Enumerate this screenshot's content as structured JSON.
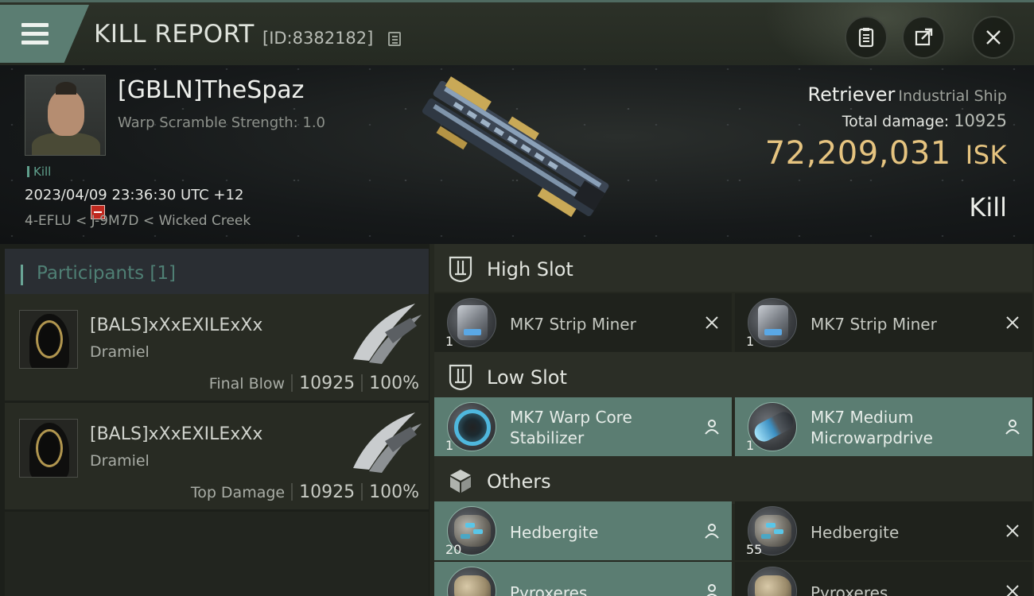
{
  "header": {
    "title": "KILL REPORT",
    "report_id": "[ID:8382182]",
    "buttons": [
      "clipboard-icon",
      "share-icon",
      "close-icon"
    ]
  },
  "victim": {
    "pilot_name": "[GBLN]TheSpaz",
    "warp_scramble": "Warp Scramble Strength: 1.0",
    "kill_tag": "Kill",
    "datetime": "2023/04/09 23:36:30 UTC +12",
    "location": "4-EFLU < J-9M7D < Wicked Creek",
    "ship_name": "Retriever",
    "ship_class": "Industrial Ship",
    "total_damage_label": "Total damage:",
    "total_damage_value": "10925",
    "isk_value": "72,209,031",
    "isk_unit": "ISK",
    "result": "Kill"
  },
  "participants": {
    "title": "Participants [1]",
    "rows": [
      {
        "name": "[BALS]xXxEXILExXx",
        "ship": "Dramiel",
        "role": "Final Blow",
        "damage": "10925",
        "percent": "100%"
      },
      {
        "name": "[BALS]xXxEXILExXx",
        "ship": "Dramiel",
        "role": "Top Damage",
        "damage": "10925",
        "percent": "100%"
      }
    ]
  },
  "slots": {
    "high": {
      "title": "High Slot",
      "items": [
        {
          "name": "MK7 Strip Miner",
          "qty": "1",
          "status": "destroyed"
        },
        {
          "name": "MK7 Strip Miner",
          "qty": "1",
          "status": "destroyed"
        }
      ]
    },
    "low": {
      "title": "Low Slot",
      "items": [
        {
          "name_line1": "MK7 Warp Core",
          "name_line2": "Stabilizer",
          "qty": "1",
          "status": "dropped"
        },
        {
          "name_line1": "MK7 Medium",
          "name_line2": "Microwarpdrive",
          "qty": "1",
          "status": "dropped"
        }
      ]
    },
    "others": {
      "title": "Others",
      "items": [
        {
          "name": "Hedbergite",
          "qty": "20",
          "status": "dropped"
        },
        {
          "name": "Hedbergite",
          "qty": "55",
          "status": "destroyed"
        },
        {
          "name": "Pyroxeres",
          "qty": "",
          "status": "dropped"
        },
        {
          "name": "Pyroxeres",
          "qty": "",
          "status": "destroyed"
        }
      ]
    }
  },
  "colors": {
    "accent": "#5b7d72",
    "isk": "#e6c480",
    "destroyed_bg": "#1f221c",
    "dropped_bg": "#5b7d72"
  }
}
